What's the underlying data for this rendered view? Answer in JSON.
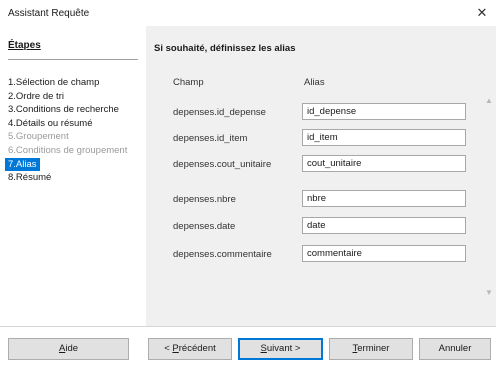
{
  "window": {
    "title": "Assistant Requête",
    "close_symbol": "✕"
  },
  "steps": {
    "title": "Étapes",
    "items": [
      {
        "label": "1.Sélection de champ",
        "state": "normal"
      },
      {
        "label": "2.Ordre de tri",
        "state": "normal"
      },
      {
        "label": "3.Conditions de recherche",
        "state": "normal"
      },
      {
        "label": "4.Détails ou résumé",
        "state": "normal"
      },
      {
        "label": "5.Groupement",
        "state": "disabled"
      },
      {
        "label": "6.Conditions de groupement",
        "state": "disabled"
      },
      {
        "label": "7.Alias",
        "state": "active"
      },
      {
        "label": "8.Résumé",
        "state": "normal"
      }
    ]
  },
  "main": {
    "section_title": "Si souhaité, définissez les alias",
    "col_field": "Champ",
    "col_alias": "Alias",
    "rows": [
      {
        "field": "depenses.id_depense",
        "alias": "id_depense"
      },
      {
        "field": "depenses.id_item",
        "alias": "id_item"
      },
      {
        "field": "depenses.cout_unitaire",
        "alias": "cout_unitaire"
      },
      {
        "field": "depenses.nbre",
        "alias": "nbre"
      },
      {
        "field": "depenses.date",
        "alias": "date"
      },
      {
        "field": "depenses.commentaire",
        "alias": "commentaire"
      }
    ]
  },
  "buttons": {
    "help_accel": "A",
    "help_rest": "ide",
    "prev_pre": "< ",
    "prev_accel": "P",
    "prev_rest": "récédent",
    "next_accel": "S",
    "next_rest": "uivant >",
    "finish_accel": "T",
    "finish_rest": "erminer",
    "cancel": "Annuler"
  },
  "colors": {
    "accent": "#0078d7",
    "panel": "#f0f0f0",
    "disabled_text": "#9a9a9a"
  }
}
